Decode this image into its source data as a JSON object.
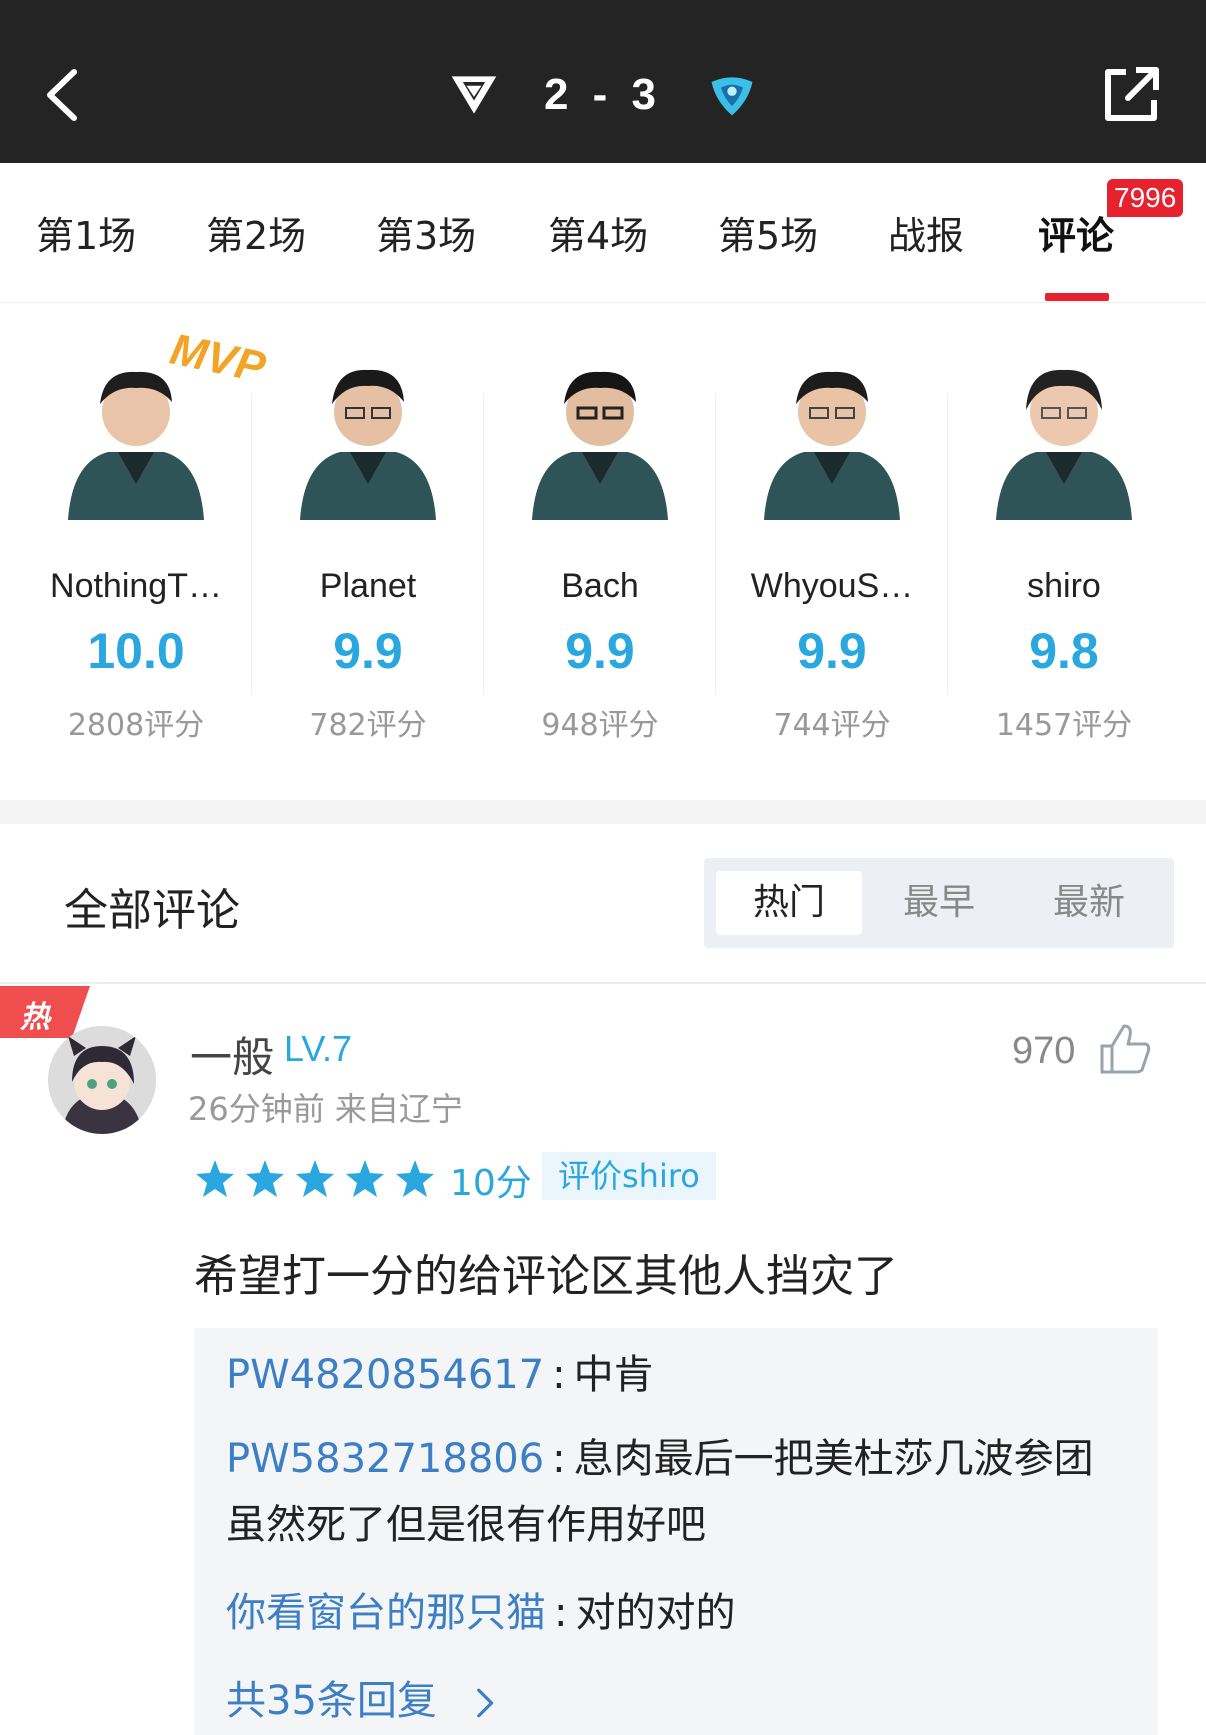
{
  "header": {
    "score": "2 - 3",
    "back_icon": "chevron-left-icon",
    "share_icon": "share-external-icon",
    "team_left_logo": "team-logo-left",
    "team_right_logo": "team-logo-right"
  },
  "tabs": {
    "items": [
      {
        "label": "第1场"
      },
      {
        "label": "第2场"
      },
      {
        "label": "第3场"
      },
      {
        "label": "第4场"
      },
      {
        "label": "第5场"
      },
      {
        "label": "战报"
      },
      {
        "label": "评论"
      }
    ],
    "active_index": 6,
    "badge": "7996",
    "accent": "#e5222e"
  },
  "players": [
    {
      "name": "NothingT…",
      "score": "10.0",
      "count": "2808评分",
      "mvp": "MVP"
    },
    {
      "name": "Planet",
      "score": "9.9",
      "count": "782评分"
    },
    {
      "name": "Bach",
      "score": "9.9",
      "count": "948评分"
    },
    {
      "name": "WhyouS…",
      "score": "9.9",
      "count": "744评分"
    },
    {
      "name": "shiro",
      "score": "9.8",
      "count": "1457评分"
    }
  ],
  "comments_section": {
    "title": "全部评论",
    "sort": {
      "options": [
        "热门",
        "最早",
        "最新"
      ],
      "active": "热门"
    }
  },
  "comment": {
    "hot_badge": "热",
    "username": "一般",
    "level": "LV.7",
    "meta": "26分钟前 来自辽宁",
    "likes": "970",
    "stars": 5,
    "rating": "10分",
    "target": "评价shiro",
    "text": "希望打一分的给评论区其他人挡灾了",
    "replies": [
      {
        "user": "PW4820854617",
        "sep": ":",
        "text": "中肯"
      },
      {
        "user": "PW5832718806",
        "sep": ":",
        "text": "息肉最后一把美杜莎几波参团",
        "text2": "虽然死了但是很有作用好吧"
      },
      {
        "user": "你看窗台的那只猫",
        "sep": ":",
        "text": "对的对的"
      }
    ],
    "more_replies": "共35条回复"
  },
  "colors": {
    "header_bg": "#242424",
    "score_blue": "#2aa7df",
    "reply_user": "#3c7fc4",
    "mvp_orange": "#f2a427"
  }
}
